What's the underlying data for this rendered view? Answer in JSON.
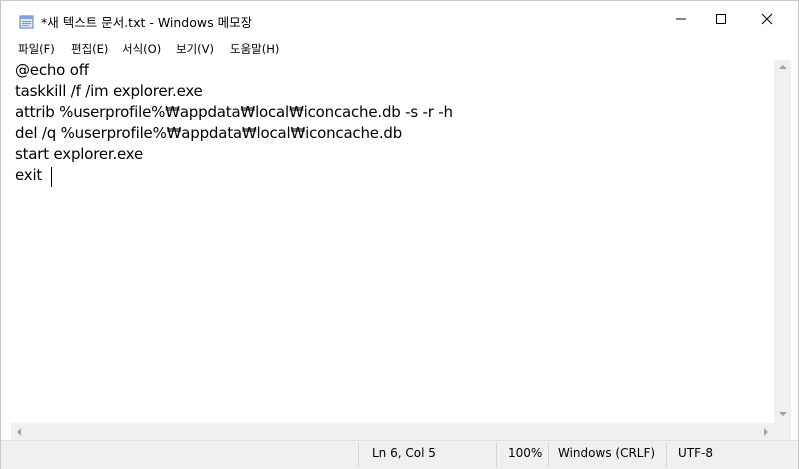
{
  "window": {
    "title": "*새 텍스트 문서.txt - Windows 메모장"
  },
  "menu": {
    "items": [
      {
        "label": "파일(F)"
      },
      {
        "label": "편집(E)"
      },
      {
        "label": "서식(O)"
      },
      {
        "label": "보기(V)"
      },
      {
        "label": "도움말(H)"
      }
    ]
  },
  "editor": {
    "lines": [
      "@echo off",
      "taskkill /f /im explorer.exe",
      "attrib %userprofile%₩appdata₩local₩iconcache.db -s -r -h",
      "del /q %userprofile%₩appdata₩local₩iconcache.db",
      "start explorer.exe",
      "exit"
    ]
  },
  "status": {
    "position": "Ln 6, Col 5",
    "zoom": "100%",
    "line_ending": "Windows (CRLF)",
    "encoding": "UTF-8"
  },
  "icons": {
    "app": "notepad-icon",
    "minimize": "minimize-icon",
    "maximize": "maximize-icon",
    "close": "close-icon"
  }
}
